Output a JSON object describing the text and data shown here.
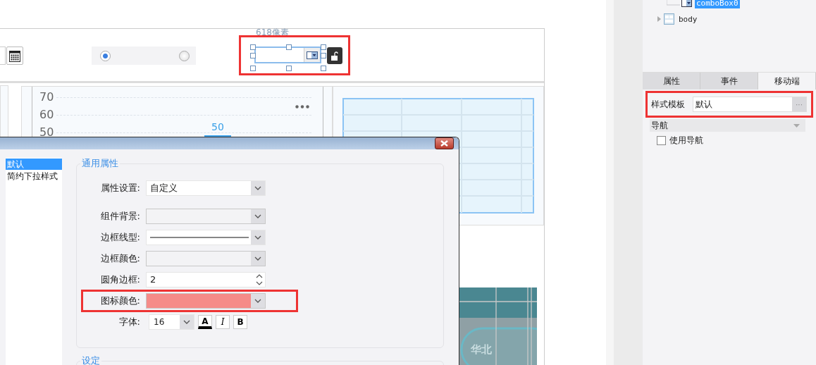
{
  "canvas": {
    "ruler_label": "618像素",
    "radios": [
      {
        "selected": true
      },
      {
        "selected": false
      }
    ],
    "combo": {
      "selected": true,
      "highlighted": true
    },
    "chart": {
      "y_ticks": [
        "70",
        "60",
        "50"
      ],
      "value_label": "50"
    },
    "map_label": "华北"
  },
  "dialog": {
    "styles": [
      {
        "label": "默认",
        "selected": true
      },
      {
        "label": "简约下拉样式",
        "selected": false
      }
    ],
    "groups": [
      {
        "title": "通用属性"
      },
      {
        "title": "设定"
      }
    ],
    "rows": [
      {
        "kind": "select",
        "label": "属性设置:",
        "value": "自定义",
        "highlighted": false
      },
      {
        "kind": "color",
        "label": "组件背景:",
        "highlighted": false
      },
      {
        "kind": "line",
        "label": "边框线型:",
        "highlighted": false
      },
      {
        "kind": "color",
        "label": "边框颜色:",
        "highlighted": false
      },
      {
        "kind": "spinner",
        "label": "圆角边框:",
        "value": "2",
        "highlighted": false
      },
      {
        "kind": "color",
        "label": "图标颜色:",
        "color": "#f58b88",
        "highlighted": true
      },
      {
        "kind": "font",
        "label": "字体:",
        "value": "16",
        "highlighted": false
      }
    ],
    "font_buttons": [
      {
        "kind": "color",
        "label": "A"
      },
      {
        "kind": "italic",
        "label": "I"
      },
      {
        "kind": "bold",
        "label": "B"
      }
    ]
  },
  "panel": {
    "tree": [
      {
        "kind": "combo",
        "label": "comboBox0",
        "selected": true
      },
      {
        "kind": "body",
        "label": "body",
        "selected": false
      }
    ],
    "tabs": [
      {
        "label": "属性",
        "selected": false
      },
      {
        "label": "事件",
        "selected": false
      },
      {
        "label": "移动端",
        "selected": true
      }
    ],
    "style_template": {
      "label": "样式模板",
      "value": "默认",
      "button": "···",
      "highlighted": true
    },
    "section": {
      "title": "导航"
    },
    "checkbox": {
      "label": "使用导航",
      "checked": false
    }
  }
}
